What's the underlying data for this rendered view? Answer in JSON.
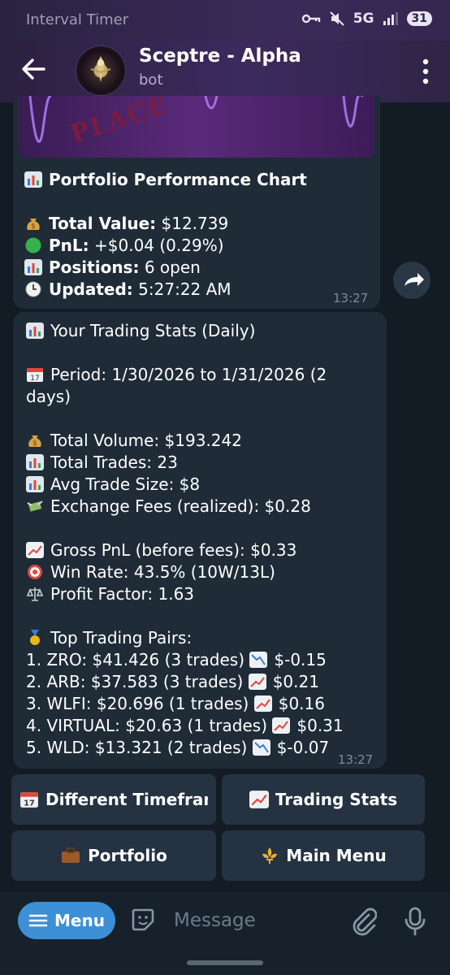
{
  "status_bar": {
    "app_name": "Interval Timer",
    "network": "5G",
    "battery": "31",
    "icons": [
      "key-icon",
      "mute-icon",
      "signal-icon"
    ]
  },
  "header": {
    "title": "Sceptre - Alpha",
    "subtitle": "bot"
  },
  "message1": {
    "image_text": "PLACE",
    "title": "Portfolio Performance Chart",
    "rows": [
      {
        "icon": "money-bag-icon",
        "label": "Total Value:",
        "value": " $12.739"
      },
      {
        "icon": "green-circle-icon",
        "label": "PnL:",
        "value": " +$0.04 (0.29%)"
      },
      {
        "icon": "chart-icon",
        "label": "Positions:",
        "value": " 6 open"
      },
      {
        "icon": "clock-icon",
        "label": "Updated:",
        "value": " 5:27:22 AM"
      }
    ],
    "time": "13:27"
  },
  "message2": {
    "title": "Your Trading Stats (Daily)",
    "period_line1": "Period: 1/30/2026 to 1/31/2026 (2",
    "period_line2": "days)",
    "volume": "Total Volume: $193.242",
    "trades": "Total Trades: 23",
    "avg": "Avg Trade Size: $8",
    "fees": "Exchange Fees (realized): $0.28",
    "gross": "Gross PnL (before fees): $0.33",
    "winrate": "Win Rate: 43.5% (10W/13L)",
    "factor": "Profit Factor: 1.63",
    "pairs_title": "Top Trading Pairs:",
    "pairs": [
      {
        "text": "1. ZRO: $41.426 (3 trades)",
        "trend": "down",
        "pnl": "$-0.15"
      },
      {
        "text": "2. ARB: $37.583 (3 trades)",
        "trend": "up",
        "pnl": "$0.21"
      },
      {
        "text": "3. WLFI: $20.696 (1 trades)",
        "trend": "up",
        "pnl": "$0.16"
      },
      {
        "text": "4. VIRTUAL: $20.63 (1 trades)",
        "trend": "up",
        "pnl": "$0.31"
      },
      {
        "text": "5. WLD: $13.321 (2 trades)",
        "trend": "down",
        "pnl": "$-0.07"
      }
    ],
    "time": "13:27"
  },
  "keyboard": {
    "different_timeframe": "Different Timeframe",
    "trading_stats": "Trading Stats",
    "portfolio": "Portfolio",
    "main_menu": "Main Menu"
  },
  "input_bar": {
    "menu_label": "Menu",
    "placeholder": "Message"
  },
  "colors": {
    "accent": "#3d8fd6",
    "bubble": "#1f2c38",
    "header": "#3c2a5e",
    "trend_up": "#e0483e",
    "trend_down": "#3a7bd5"
  }
}
